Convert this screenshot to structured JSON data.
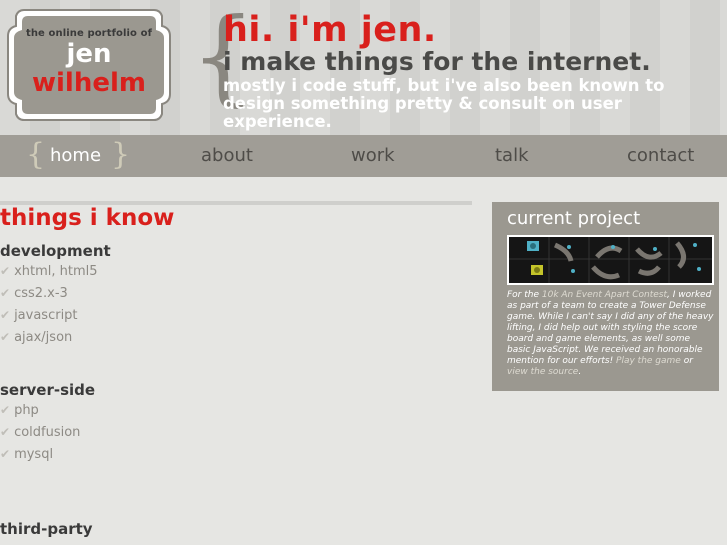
{
  "header": {
    "badge_tagline": "the online portfolio of",
    "badge_first": "jen",
    "badge_last": "wilhelm",
    "headline": "hi. i'm jen.",
    "subheadline": "i make things for the internet.",
    "tagline": "mostly i code stuff, but i've also been known to design something pretty & consult on user experience."
  },
  "nav": {
    "items": [
      {
        "label": "home",
        "active": true
      },
      {
        "label": "about",
        "active": false
      },
      {
        "label": "work",
        "active": false
      },
      {
        "label": "talk",
        "active": false
      },
      {
        "label": "contact",
        "active": false
      }
    ]
  },
  "main": {
    "title": "things i know",
    "groups": [
      {
        "title": "development",
        "items": [
          "xhtml, html5",
          "css2.x-3",
          "javascript",
          "ajax/json"
        ]
      },
      {
        "title": "server-side",
        "items": [
          "php",
          "coldfusion",
          "mysql"
        ]
      },
      {
        "title": "third-party",
        "items": []
      }
    ]
  },
  "sidebar": {
    "title": "current project",
    "text_1": "For the ",
    "link_contest": "10k An Event Apart Contest",
    "text_2": ", I worked as part of a team to create a Tower Defense game. While I can't say I did any of the heavy lifting, I did help out with styling the score board and game elements, as well some basic JavaScript. We received an honorable mention for our efforts! ",
    "link_play": "Play the game",
    "text_3": " or ",
    "link_source": "view the source",
    "text_4": "."
  },
  "colors": {
    "accent_red": "#d9201c",
    "nav_bg": "#a09d96",
    "panel_bg": "#9b9890"
  }
}
